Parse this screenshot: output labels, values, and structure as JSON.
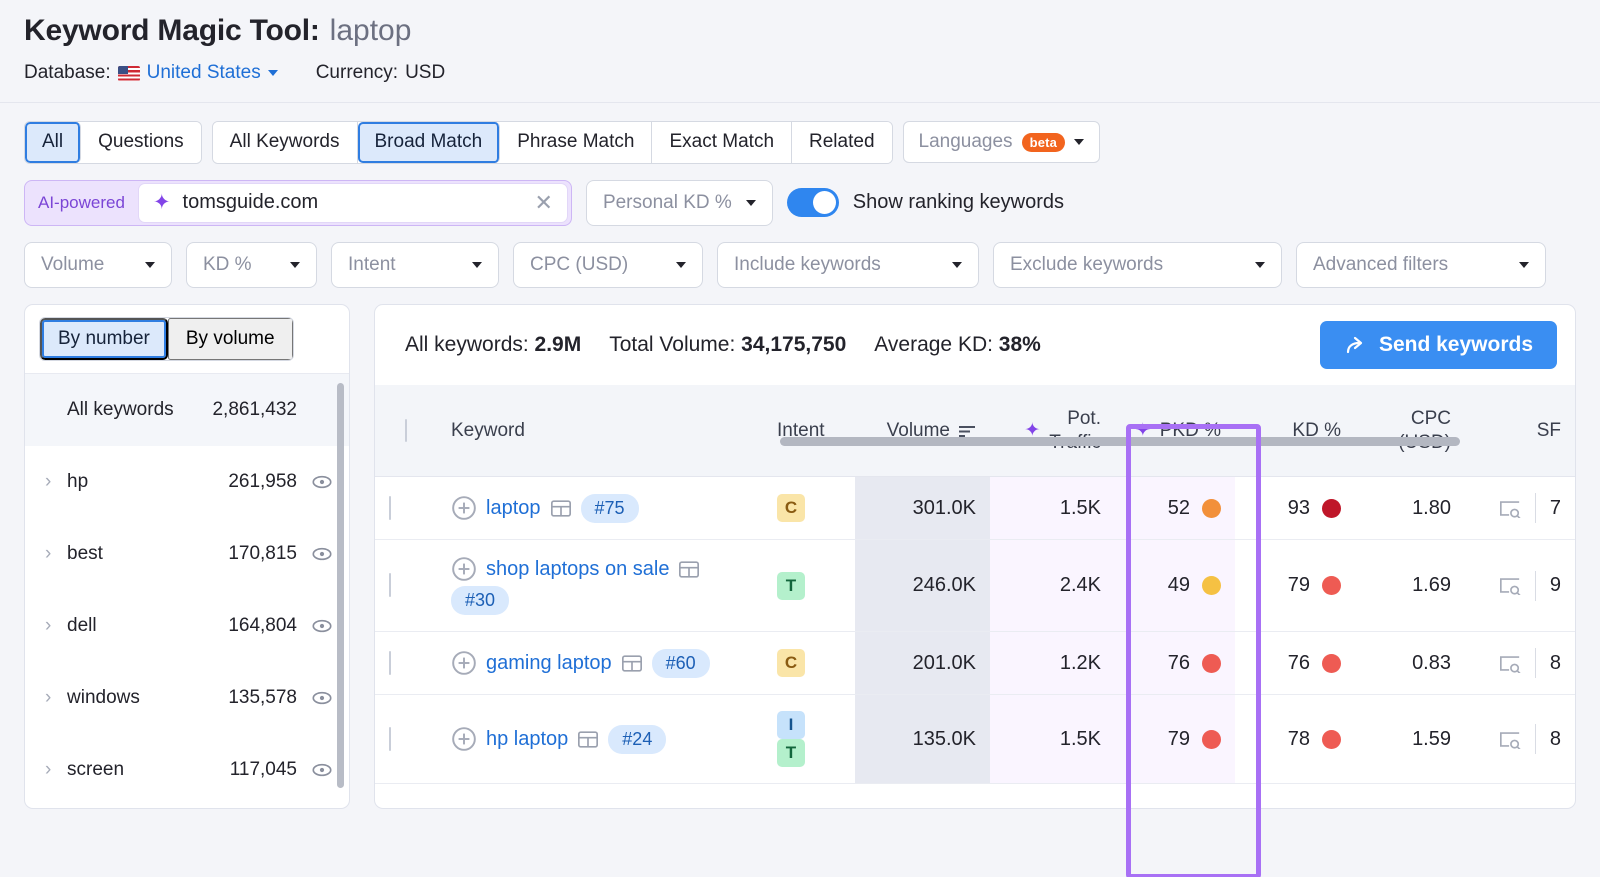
{
  "header": {
    "tool_name": "Keyword Magic Tool:",
    "keyword": "laptop",
    "database_label": "Database:",
    "database_value": "United States",
    "currency_label": "Currency:",
    "currency_value": "USD"
  },
  "filters": {
    "group1": [
      {
        "label": "All",
        "active": true
      },
      {
        "label": "Questions",
        "active": false
      }
    ],
    "group2": [
      {
        "label": "All Keywords",
        "active": false
      },
      {
        "label": "Broad Match",
        "active": true
      },
      {
        "label": "Phrase Match",
        "active": false
      },
      {
        "label": "Exact Match",
        "active": false
      },
      {
        "label": "Related",
        "active": false
      }
    ],
    "languages_label": "Languages",
    "languages_badge": "beta",
    "ai_label": "AI-powered",
    "ai_domain": "tomsguide.com",
    "personal_kd_label": "Personal KD %",
    "ranking_toggle_label": "Show ranking keywords",
    "dropdowns": [
      {
        "label": "Volume"
      },
      {
        "label": "KD %"
      },
      {
        "label": "Intent"
      },
      {
        "label": "CPC (USD)"
      },
      {
        "label": "Include keywords"
      },
      {
        "label": "Exclude keywords"
      },
      {
        "label": "Advanced filters"
      }
    ]
  },
  "sidebar": {
    "tabs": [
      {
        "label": "By number",
        "active": true
      },
      {
        "label": "By volume",
        "active": false
      }
    ],
    "all_keywords_label": "All keywords",
    "all_keywords_count": "2,861,432",
    "items": [
      {
        "label": "hp",
        "count": "261,958"
      },
      {
        "label": "best",
        "count": "170,815"
      },
      {
        "label": "dell",
        "count": "164,804"
      },
      {
        "label": "windows",
        "count": "135,578"
      },
      {
        "label": "screen",
        "count": "117,045"
      }
    ]
  },
  "summary": {
    "all_keywords_label": "All keywords:",
    "all_keywords_value": "2.9M",
    "total_volume_label": "Total Volume:",
    "total_volume_value": "34,175,750",
    "average_kd_label": "Average KD:",
    "average_kd_value": "38%",
    "send_button": "Send keywords"
  },
  "table": {
    "columns": {
      "keyword": "Keyword",
      "intent": "Intent",
      "volume": "Volume",
      "pot_traffic_line1": "Pot.",
      "pot_traffic_line2": "Traffic",
      "pkd": "PKD %",
      "kd": "KD %",
      "cpc_line1": "CPC",
      "cpc_line2": "(USD)",
      "sf": "SF"
    },
    "rows": [
      {
        "keyword": "laptop",
        "position": "#75",
        "intents": [
          "C"
        ],
        "volume": "301.0K",
        "pot_traffic": "1.5K",
        "pkd": "52",
        "pkd_color": "#f2903a",
        "kd": "93",
        "kd_color": "#bf1629",
        "cpc": "1.80",
        "sf": "7"
      },
      {
        "keyword": "shop laptops on sale",
        "position": "#30",
        "intents": [
          "T"
        ],
        "volume": "246.0K",
        "pot_traffic": "2.4K",
        "pkd": "49",
        "pkd_color": "#f5c143",
        "kd": "79",
        "kd_color": "#ee5b53",
        "cpc": "1.69",
        "sf": "9"
      },
      {
        "keyword": "gaming laptop",
        "position": "#60",
        "intents": [
          "C"
        ],
        "volume": "201.0K",
        "pot_traffic": "1.2K",
        "pkd": "76",
        "pkd_color": "#ee5b53",
        "kd": "76",
        "kd_color": "#ee5b53",
        "cpc": "0.83",
        "sf": "8"
      },
      {
        "keyword": "hp laptop",
        "position": "#24",
        "intents": [
          "I",
          "T"
        ],
        "volume": "135.0K",
        "pot_traffic": "1.5K",
        "pkd": "79",
        "pkd_color": "#ee5b53",
        "kd": "78",
        "kd_color": "#ee5b53",
        "cpc": "1.59",
        "sf": "8"
      }
    ]
  },
  "colors": {
    "accent_blue": "#3a8ef2",
    "link_blue": "#1f6fd6",
    "highlight_purple": "#a870f5",
    "ai_purple": "#7b45d6",
    "beta_orange": "#f2641e"
  }
}
